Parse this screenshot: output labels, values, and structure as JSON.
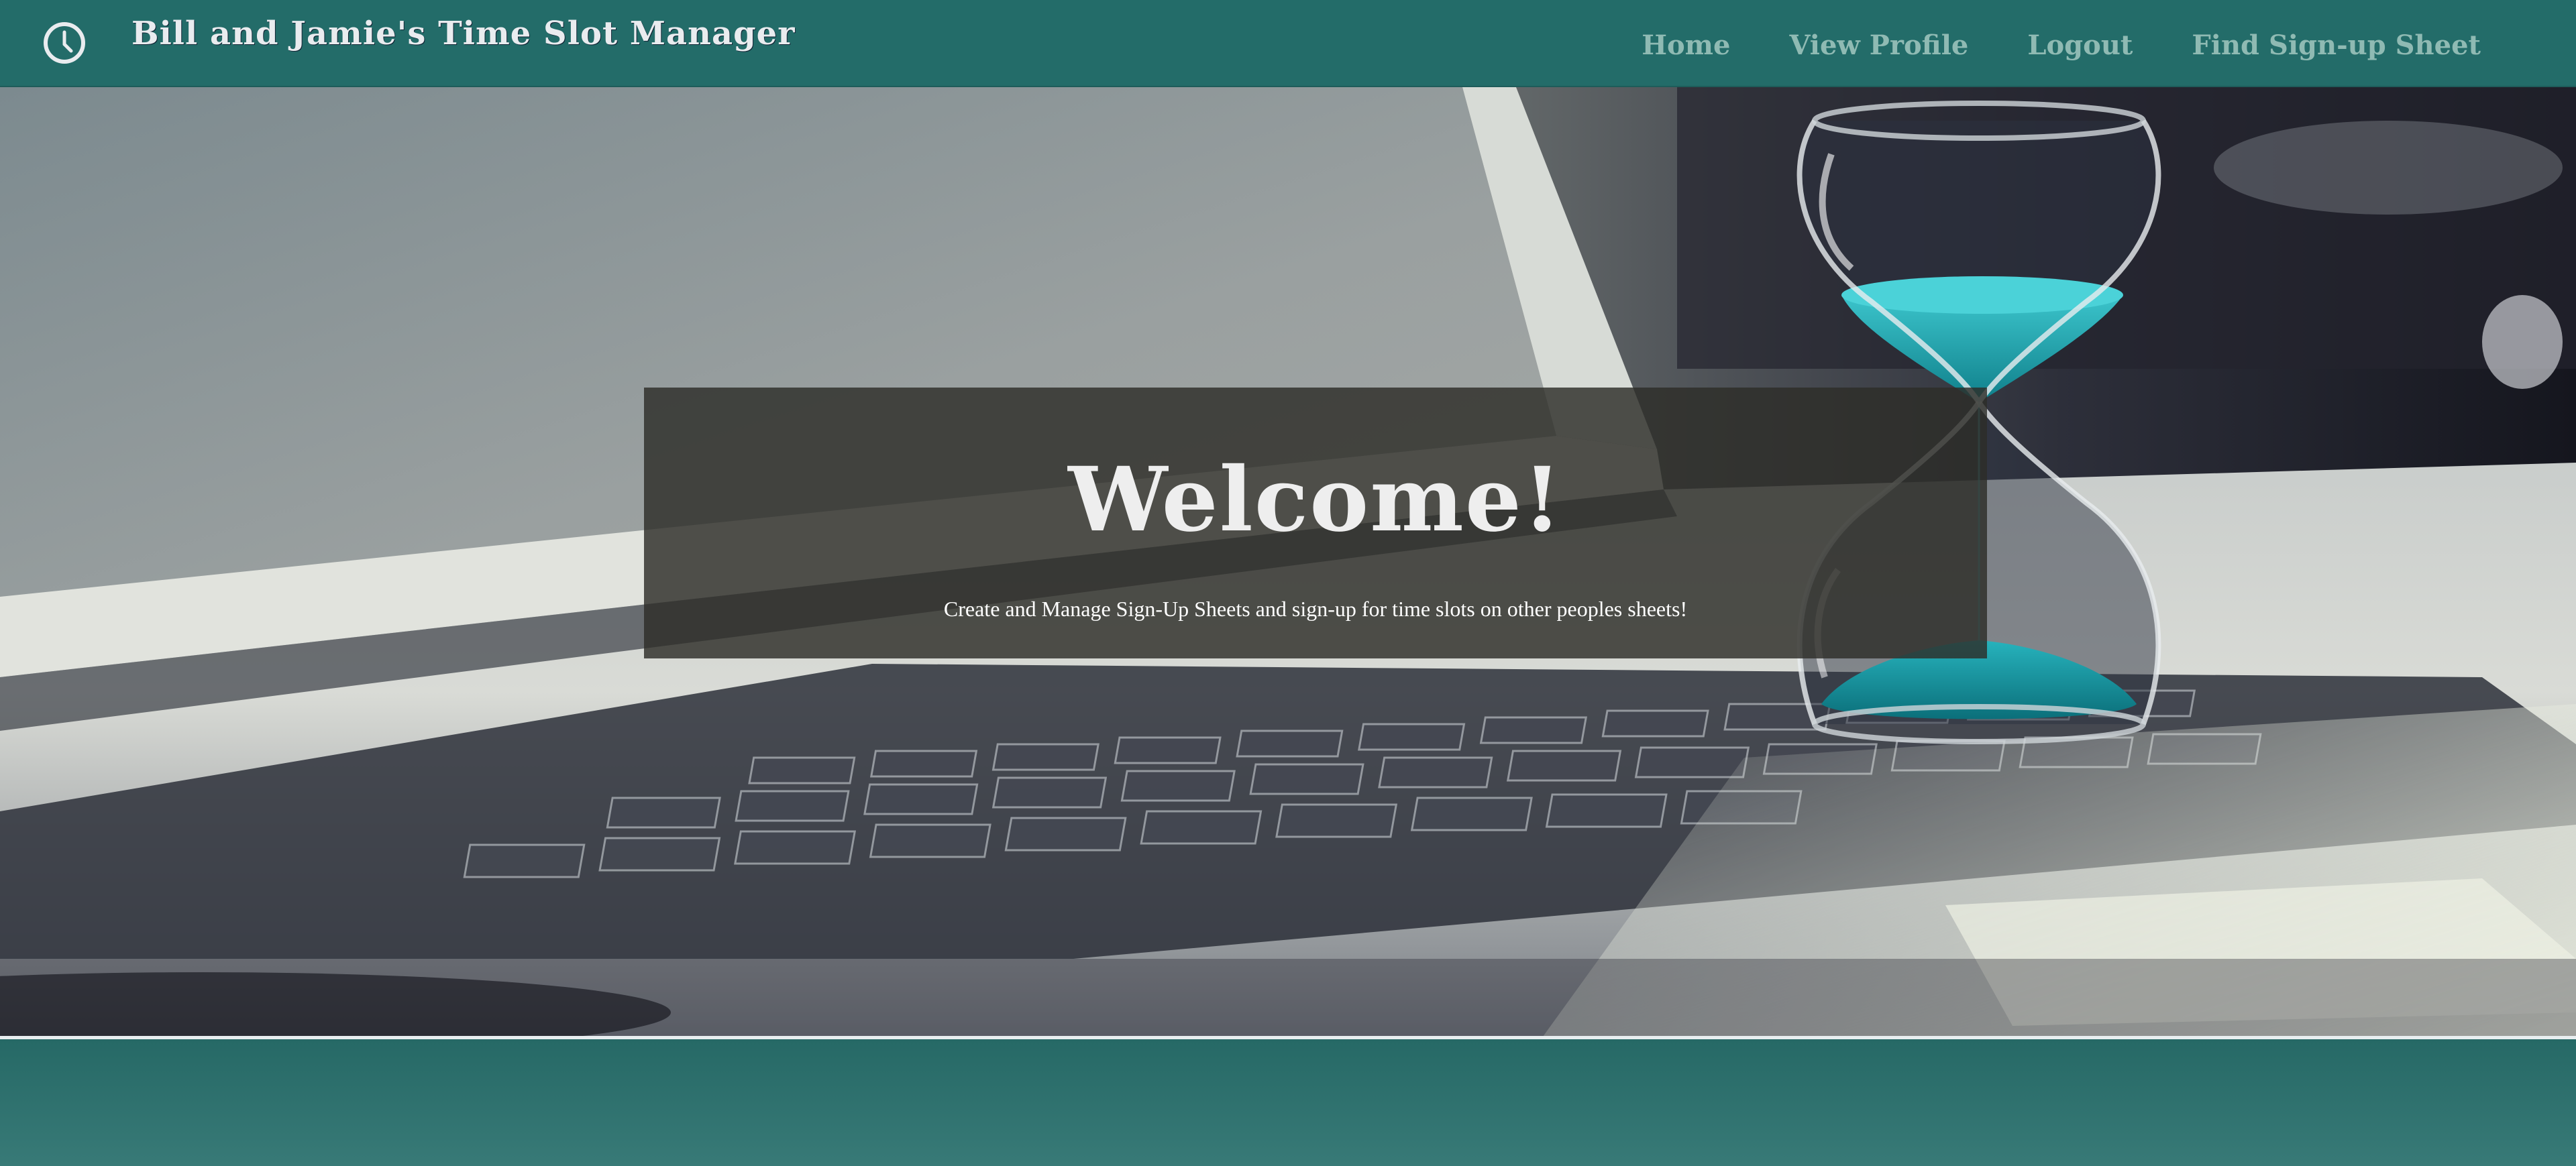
{
  "navbar": {
    "brand_title": "Bill and Jamie's Time Slot Manager",
    "brand_icon": "clock-icon",
    "links": [
      {
        "label": "Home"
      },
      {
        "label": "View Profile"
      },
      {
        "label": "Logout"
      },
      {
        "label": "Find Sign-up Sheet"
      }
    ]
  },
  "hero": {
    "background_image": "laptop-with-hourglass-photo",
    "welcome_title": "Welcome!",
    "welcome_subtitle": "Create and Manage Sign-Up Sheets and sign-up for time slots on other peoples sheets!"
  },
  "colors": {
    "navbar_bg": "#236c69",
    "nav_link": "#8fbab3",
    "brand_text": "#e9ecef",
    "sand": "#1aa3ad",
    "footer_bg": "#2a6f6c"
  }
}
